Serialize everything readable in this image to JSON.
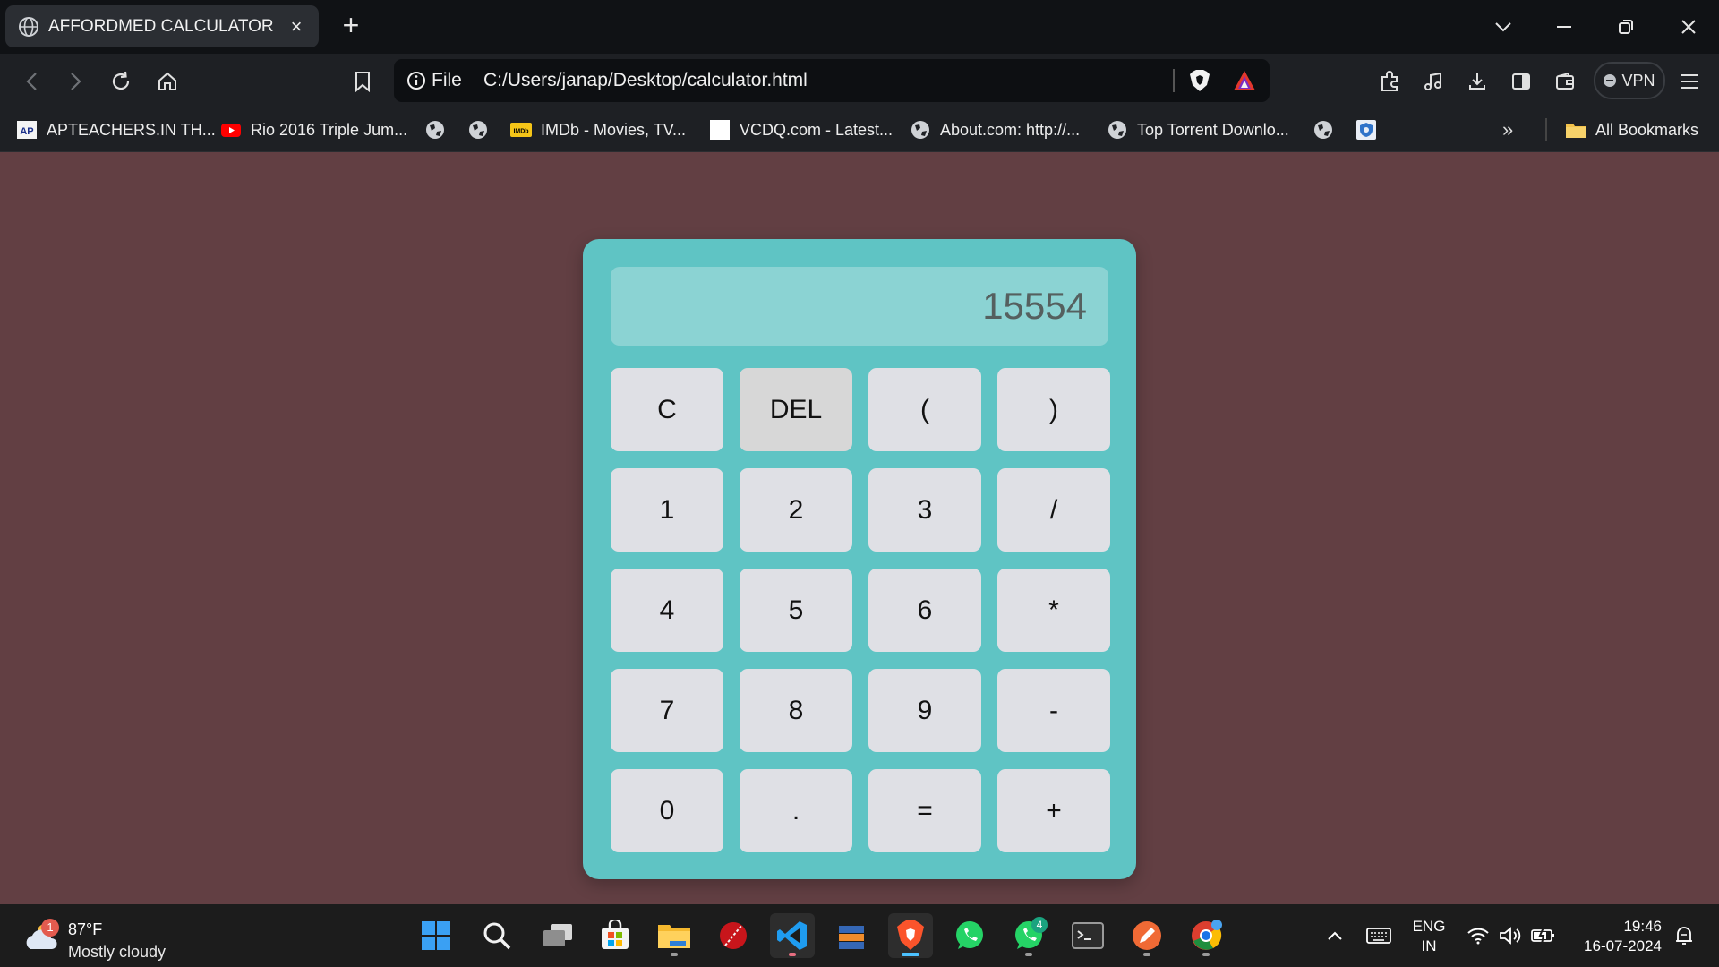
{
  "browser": {
    "tab": {
      "title": "AFFORDMED CALCULATOR",
      "close_glyph": "×",
      "favicon": "globe-icon"
    },
    "new_tab_glyph": "+",
    "window_controls": [
      "tab-search-icon",
      "minimize-icon",
      "restore-icon",
      "close-icon"
    ],
    "address": {
      "scheme": "File",
      "url": "C:/Users/janap/Desktop/calculator.html"
    },
    "vpn_label": "VPN",
    "bookmarks": [
      {
        "label": "APTEACHERS.IN TH...",
        "icon": "ap-favicon"
      },
      {
        "label": "Rio 2016 Triple Jum...",
        "icon": "youtube-icon"
      },
      {
        "label": "",
        "icon": "globe-icon"
      },
      {
        "label": "",
        "icon": "globe-icon"
      },
      {
        "label": "IMDb - Movies, TV...",
        "icon": "imdb-icon"
      },
      {
        "label": "VCDQ.com - Latest...",
        "icon": "white-square-icon"
      },
      {
        "label": "About.com: http://...",
        "icon": "globe-icon"
      },
      {
        "label": "Top Torrent Downlo...",
        "icon": "globe-icon"
      },
      {
        "label": "",
        "icon": "globe-icon"
      },
      {
        "label": "",
        "icon": "shield-favicon"
      }
    ],
    "bookmarks_overflow": "»",
    "all_bookmarks": "All Bookmarks"
  },
  "calculator": {
    "display": "15554",
    "keys": [
      "C",
      "DEL",
      "(",
      ")",
      "1",
      "2",
      "3",
      "/",
      "4",
      "5",
      "6",
      "*",
      "7",
      "8",
      "9",
      "-",
      "0",
      ".",
      "=",
      "+"
    ],
    "hovered_key": "DEL"
  },
  "taskbar": {
    "weather": {
      "temp": "87°F",
      "condition": "Mostly cloudy",
      "badge": "1"
    },
    "apps": [
      "start",
      "search",
      "task-view",
      "store",
      "file-explorer",
      "cricket-app",
      "vscode",
      "archive-app",
      "brave",
      "whatsapp",
      "whatsapp-beta",
      "terminal",
      "paint-app",
      "chrome"
    ],
    "whatsapp_badge": "4",
    "language": {
      "line1": "ENG",
      "line2": "IN"
    },
    "time": "19:46",
    "date": "16-07-2024"
  },
  "colors": {
    "page_bg": "#623f43",
    "calc_body": "#5fc4c4",
    "display_bg": "#8bd3d3",
    "key_bg": "#dfe0e5",
    "key_active": "#d7d7d7"
  }
}
